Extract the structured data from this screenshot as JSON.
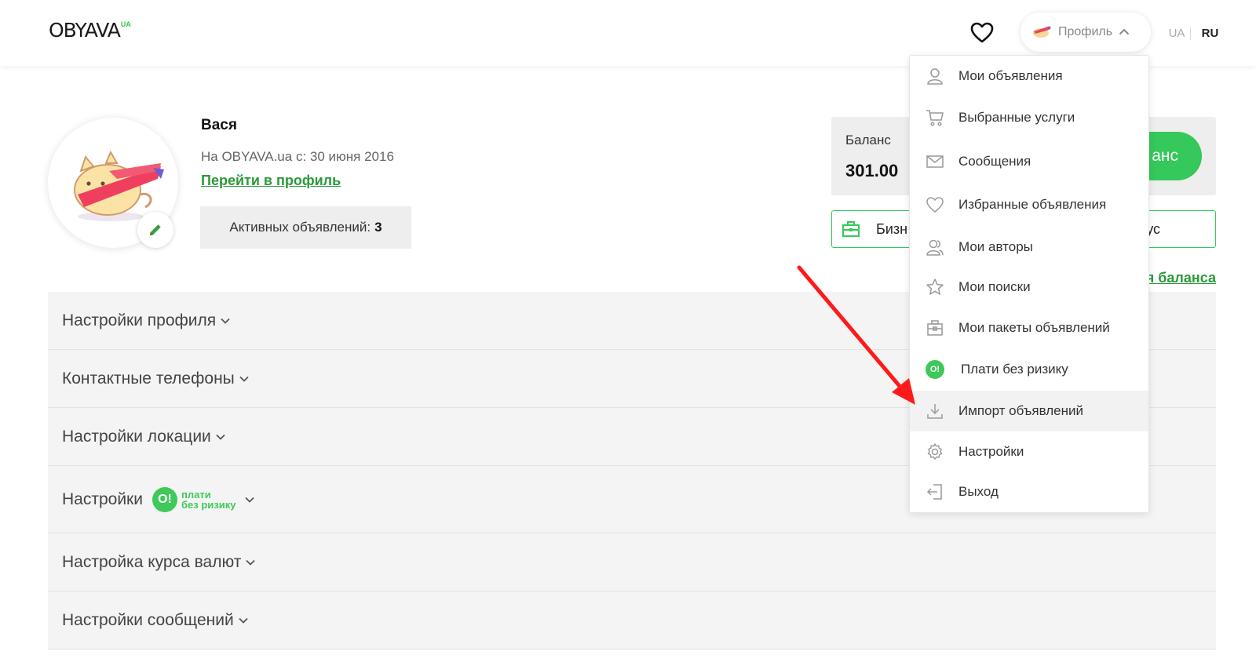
{
  "header": {
    "logo_text": "OBYAVA",
    "logo_suffix": "UA",
    "profile_label": "Профиль",
    "lang_ua": "UA",
    "lang_ru": "RU"
  },
  "profile": {
    "name": "Вася",
    "since": "На OBYAVA.ua с: 30 июня 2016",
    "profile_link": "Перейти в профиль",
    "active_label": "Активных объявлений:",
    "active_count": "3"
  },
  "balance": {
    "label": "Баланс",
    "value": "301.00",
    "topup_partial": "анс",
    "business_partial": "Бизн",
    "business_tail": "ус",
    "history_partial": "я баланса"
  },
  "accordion": [
    {
      "label": "Настройки профиля"
    },
    {
      "label": "Контактные телефоны"
    },
    {
      "label": "Настройки локации"
    },
    {
      "label": "Настройки",
      "tag_letter": "O!",
      "tag_line1": "плати",
      "tag_line2": "без ризику"
    },
    {
      "label": "Настройка курса валют"
    },
    {
      "label": "Настройки сообщений"
    }
  ],
  "dropdown": {
    "items": [
      {
        "label": "Мои объявления",
        "icon": "user-icon"
      },
      {
        "label": "Выбранные услуги",
        "icon": "cart-icon"
      },
      {
        "label": "Сообщения",
        "icon": "envelope-icon"
      },
      {
        "label": "Избранные объявления",
        "icon": "heart-icon"
      },
      {
        "label": "Мои авторы",
        "icon": "users-icon"
      },
      {
        "label": "Мои поиски",
        "icon": "star-icon"
      },
      {
        "label": "Мои пакеты объявлений",
        "icon": "package-icon"
      },
      {
        "label": "Плати без ризику",
        "icon": "o-badge-icon",
        "badge": "O!"
      },
      {
        "label": "Импорт объявлений",
        "icon": "download-icon"
      },
      {
        "label": "Настройки",
        "icon": "gear-icon"
      },
      {
        "label": "Выход",
        "icon": "logout-icon"
      }
    ]
  },
  "colors": {
    "accent_green": "#35c85a",
    "link_green": "#2a9a3a",
    "annotation_red": "#ff1a1a"
  }
}
